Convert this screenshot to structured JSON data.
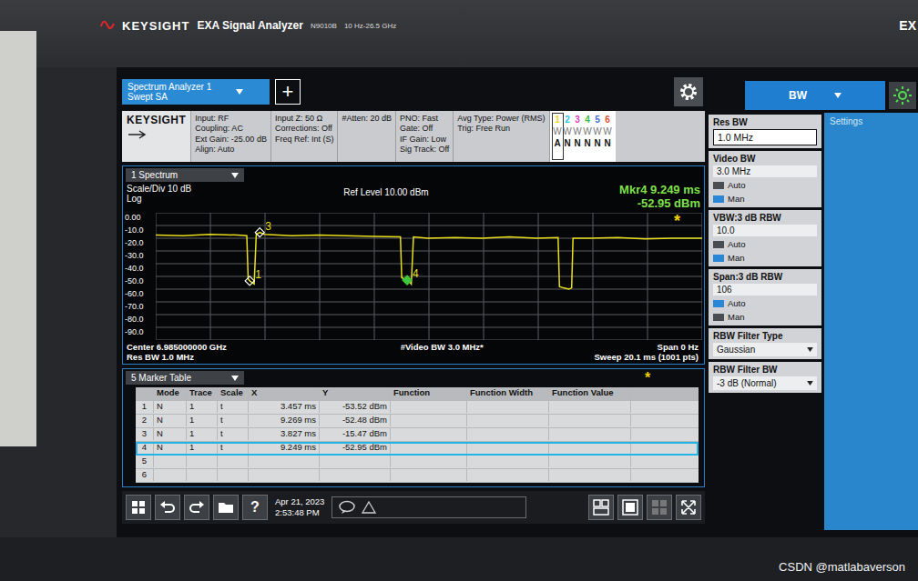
{
  "device": {
    "brand": "KEYSIGHT",
    "model_name": "EXA Signal Analyzer",
    "model": "N9010B",
    "range": "10 Hz-26.5 GHz",
    "edge_text": "EX"
  },
  "tabs": [
    {
      "label": "Spectrum Analyzer 1",
      "sublabel": "Swept SA",
      "selected": true
    }
  ],
  "add_button": "+",
  "settings_bar": {
    "logo": "KEYSIGHT",
    "columns": [
      [
        "Input: RF",
        "Coupling: AC",
        "Ext Gain: -25.00 dB",
        "Align: Auto"
      ],
      [
        "Input Z: 50 Ω",
        "Corrections: Off",
        "Freq Ref: Int (S)"
      ],
      [
        "#Atten: 20 dB"
      ],
      [
        "PNO: Fast",
        "Gate: Off",
        "IF Gain: Low",
        "Sig Track: Off"
      ],
      [
        "Avg Type: Power (RMS)",
        "Trig: Free Run"
      ]
    ],
    "traces": [
      {
        "number": "1",
        "type": "W",
        "detector": "A",
        "color": "#e8d820",
        "selected": true
      },
      {
        "number": "2",
        "type": "W",
        "detector": "N",
        "color": "#20c8e0",
        "selected": false
      },
      {
        "number": "3",
        "type": "W",
        "detector": "N",
        "color": "#e040c0",
        "selected": false
      },
      {
        "number": "4",
        "type": "W",
        "detector": "N",
        "color": "#30c040",
        "selected": false
      },
      {
        "number": "5",
        "type": "W",
        "detector": "N",
        "color": "#4070e0",
        "selected": false
      },
      {
        "number": "6",
        "type": "W",
        "detector": "N",
        "color": "#e05030",
        "selected": false
      }
    ]
  },
  "panel": {
    "title": "BW",
    "side_tab": "Settings",
    "items": [
      {
        "kind": "value",
        "label": "Res BW",
        "value": "1.0 MHz"
      },
      {
        "kind": "auto_value",
        "label": "Video BW",
        "value": "3.0 MHz",
        "options": [
          {
            "label": "Auto",
            "selected": false
          },
          {
            "label": "Man",
            "selected": true
          }
        ]
      },
      {
        "kind": "auto_value",
        "label": "VBW:3 dB RBW",
        "value": "10.0",
        "options": [
          {
            "label": "Auto",
            "selected": false
          },
          {
            "label": "Man",
            "selected": true
          }
        ]
      },
      {
        "kind": "auto_value",
        "label": "Span:3 dB RBW",
        "value": "106",
        "options": [
          {
            "label": "Auto",
            "selected": true
          },
          {
            "label": "Man",
            "selected": false
          }
        ]
      },
      {
        "kind": "dropdown",
        "label": "RBW Filter Type",
        "value": "Gaussian"
      },
      {
        "kind": "dropdown",
        "label": "RBW Filter BW",
        "value": "-3 dB (Normal)"
      }
    ]
  },
  "chart": {
    "window_label": "1 Spectrum",
    "scale": "Scale/Div 10 dB",
    "scale_type": "Log",
    "ref_level": "Ref Level 10.00 dBm",
    "marker_readout": {
      "label": "Mkr4 9.249 ms",
      "value": "-52.95 dBm"
    },
    "star": "*",
    "y_ticks": [
      "0.00",
      "-10.0",
      "-20.0",
      "-30.0",
      "-40.0",
      "-50.0",
      "-60.0",
      "-70.0",
      "-80.0",
      "-90.0"
    ],
    "y_top": 0,
    "y_bottom": -100,
    "x_span_ms": 20.1,
    "trace": {
      "x_ms": [
        0,
        1,
        2,
        3,
        3.35,
        3.4,
        3.457,
        3.55,
        3.62,
        3.7,
        3.827,
        4,
        5,
        6,
        7,
        8,
        9,
        9.05,
        9.249,
        9.269,
        9.4,
        9.48,
        10,
        11,
        12,
        13,
        14,
        14.8,
        14.85,
        15.0,
        15.2,
        15.3,
        15.35,
        16,
        17,
        18,
        19,
        20.1
      ],
      "y_dbm": [
        -17.5,
        -18,
        -17,
        -17.5,
        -18,
        -52,
        -53.52,
        -55,
        -56,
        -17,
        -15.47,
        -17,
        -18,
        -17.5,
        -18,
        -18.5,
        -19,
        -51,
        -52.95,
        -52.48,
        -56,
        -19,
        -20,
        -19.5,
        -20,
        -19,
        -20,
        -19.5,
        -58,
        -59,
        -60,
        -59,
        -20,
        -20,
        -19.5,
        -20.5,
        -20,
        -20
      ]
    },
    "markers": [
      {
        "label": "1",
        "x_ms": 3.457,
        "y_dbm": -53.52,
        "shown": true,
        "selected": false
      },
      {
        "label": "2",
        "x_ms": 9.269,
        "y_dbm": -52.48,
        "shown": false,
        "selected": false
      },
      {
        "label": "3",
        "x_ms": 3.827,
        "y_dbm": -15.47,
        "shown": true,
        "selected": false
      },
      {
        "label": "4",
        "x_ms": 9.249,
        "y_dbm": -52.95,
        "shown": true,
        "selected": true
      }
    ],
    "footer": {
      "center": "Center 6.985000000 GHz",
      "res_bw": "Res BW 1.0 MHz",
      "video_bw": "#Video BW 3.0 MHz*",
      "span": "Span 0 Hz",
      "sweep": "Sweep 20.1 ms (1001 pts)"
    }
  },
  "marker_table": {
    "title": "5 Marker Table",
    "star": "*",
    "columns": [
      "",
      "Mode",
      "Trace",
      "Scale",
      "X",
      "Y",
      "Function",
      "Function Width",
      "Function Value"
    ],
    "rows": [
      {
        "n": "1",
        "mode": "N",
        "trace": "1",
        "scale": "t",
        "x": "3.457 ms",
        "y": "-53.52 dBm",
        "selected": false
      },
      {
        "n": "2",
        "mode": "N",
        "trace": "1",
        "scale": "t",
        "x": "9.269 ms",
        "y": "-52.48 dBm",
        "selected": false
      },
      {
        "n": "3",
        "mode": "N",
        "trace": "1",
        "scale": "t",
        "x": "3.827 ms",
        "y": "-15.47 dBm",
        "selected": false
      },
      {
        "n": "4",
        "mode": "N",
        "trace": "1",
        "scale": "t",
        "x": "9.249 ms",
        "y": "-52.95 dBm",
        "selected": true
      },
      {
        "n": "5",
        "mode": "",
        "trace": "",
        "scale": "",
        "x": "",
        "y": "",
        "selected": false
      },
      {
        "n": "6",
        "mode": "",
        "trace": "",
        "scale": "",
        "x": "",
        "y": "",
        "selected": false
      }
    ]
  },
  "toolbar": {
    "help": "?",
    "date": "Apr 21, 2023",
    "time": "2:53:48 PM"
  },
  "watermark": "CSDN @matlabaverson"
}
